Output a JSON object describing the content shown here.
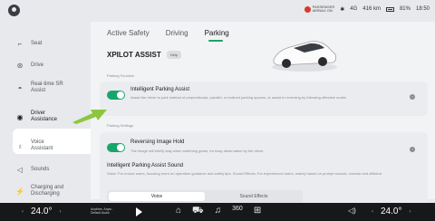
{
  "status": {
    "airbag_line1": "PASSENGER",
    "airbag_line2": "AIRBAG ON",
    "signal": "4G",
    "range": "416 km",
    "battery": "81%",
    "time": "18:50"
  },
  "sidebar": {
    "items": [
      {
        "label": "Seat",
        "icon": "seat-icon",
        "glyph": "⌐"
      },
      {
        "label": "Drive",
        "icon": "steering-wheel-icon",
        "glyph": "⊛"
      },
      {
        "label": "Real-time SR\nAssist",
        "icon": "sr-assist-icon",
        "glyph": "◓"
      },
      {
        "label": "Driver\nAssistance",
        "icon": "driver-assistance-icon",
        "glyph": "◉"
      },
      {
        "label": "Voice\nAssistant",
        "icon": "voice-icon",
        "glyph": "♁"
      },
      {
        "label": "Sounds",
        "icon": "speaker-icon",
        "glyph": "◁"
      },
      {
        "label": "Charging and\nDischarging",
        "icon": "charging-icon",
        "glyph": "⚡"
      }
    ]
  },
  "tabs": [
    "Active Safety",
    "Driving",
    "Parking"
  ],
  "main": {
    "title": "XPILOT ASSIST",
    "help_label": "Help",
    "section1": "Parking Function",
    "card1_title": "Intelligent Parking Assist",
    "card1_desc": "Assist the driver to park instead of perpendicular, parallel, or inclined parking spaces, or assist in reversing by following effective routes",
    "section2": "Parking Settings",
    "card2_title": "Reversing Image Hold",
    "card2_desc": "The image will briefly stay when switching gears, for easy observation by the driver.",
    "sound_title": "Intelligent Parking Assist Sound",
    "sound_desc": "Voice: For novice users, focusing more on operation guidance and safety tips. Sound Effects: For experienced users, mainly based on prompt sounds, concise and efficient",
    "seg_options": [
      "Voice",
      "Sound Effects"
    ]
  },
  "bottom": {
    "temp_left": "24.0°",
    "temp_right": "24.0°",
    "track_title": "Anytime, Anyw..",
    "track_artist": "Default Audio",
    "app_icons": [
      "⌂",
      "⛟",
      "♫",
      "360",
      "⊞"
    ]
  },
  "colors": {
    "accent": "#17a56b",
    "annotation_arrow": "#8cc63f"
  }
}
